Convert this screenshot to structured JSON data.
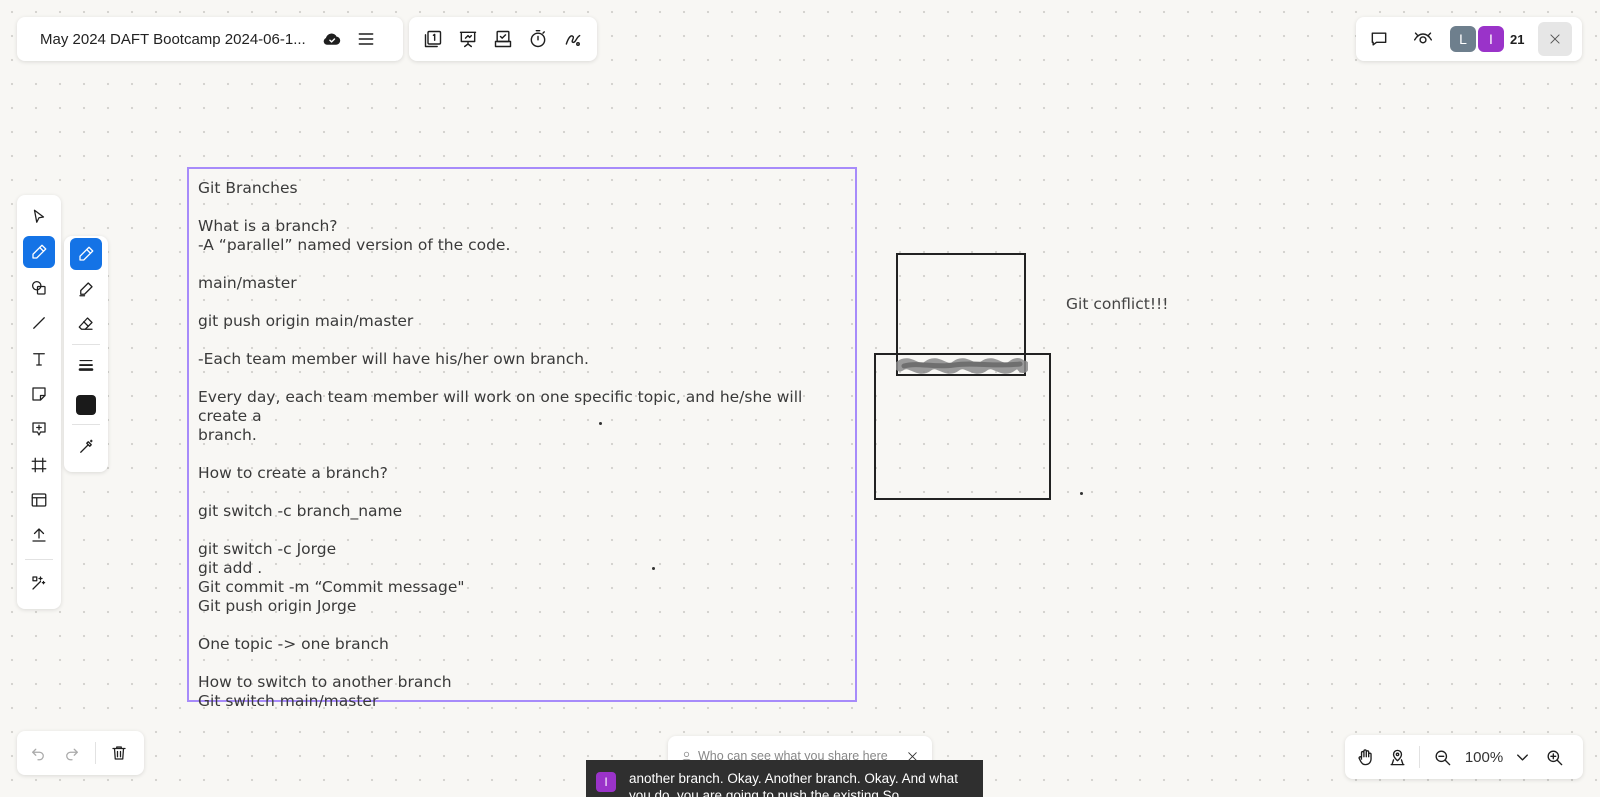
{
  "header": {
    "board_title": "May 2024 DAFT Bootcamp 2024-06-1...",
    "file_icons": [
      "cloud-sync-icon",
      "menu-icon"
    ],
    "tool_icons": [
      "pages-icon",
      "present-icon",
      "voting-icon",
      "timer-icon",
      "laser-pointer-icon"
    ]
  },
  "collaborators": {
    "avatars": [
      {
        "initial": "L",
        "color": "#6e7f8d"
      },
      {
        "initial": "I",
        "color": "#9a33c9"
      }
    ],
    "count": "21",
    "accent": "#1473e6"
  },
  "toolbar": {
    "tools": [
      "select",
      "pen",
      "shapes",
      "line",
      "text",
      "sticky-note",
      "comment",
      "frame",
      "templates",
      "upload",
      "magic"
    ],
    "active_tool": "pen",
    "pen_options": [
      "pen",
      "highlighter",
      "eraser",
      "stroke-weight",
      "color",
      "lasso"
    ],
    "pen_color": "#1a1a1a"
  },
  "note": {
    "lines": [
      "Git Branches",
      "",
      "What is a branch?",
      "-A “parallel” named version of the code.",
      "",
      "main/master",
      "",
      "git push origin main/master",
      "",
      "-Each team member will have his/her own branch.",
      "",
      "Every day, each team member will work on one specific topic, and he/she will create a",
      "branch.",
      "",
      "How to create a branch?",
      "",
      "git switch -c branch_name",
      "",
      "git switch -c Jorge",
      "git add .",
      "Git commit -m “Commit message\"",
      "Git push origin Jorge",
      "",
      "One topic -> one branch",
      "",
      "How to switch to another branch",
      "Git switch main/master"
    ],
    "frame_color": "#a78bfa"
  },
  "drawing": {
    "label": "Git conflict!!!"
  },
  "history": {
    "icons": [
      "undo-icon",
      "redo-icon",
      "trash-icon"
    ]
  },
  "zoom": {
    "level": "100%"
  },
  "share_hint": {
    "text": "Who can see what you share here"
  },
  "caption": {
    "avatar_initial": "I",
    "text": "another branch. Okay. Another branch. Okay. And what you do, you are going to push the existing So"
  }
}
